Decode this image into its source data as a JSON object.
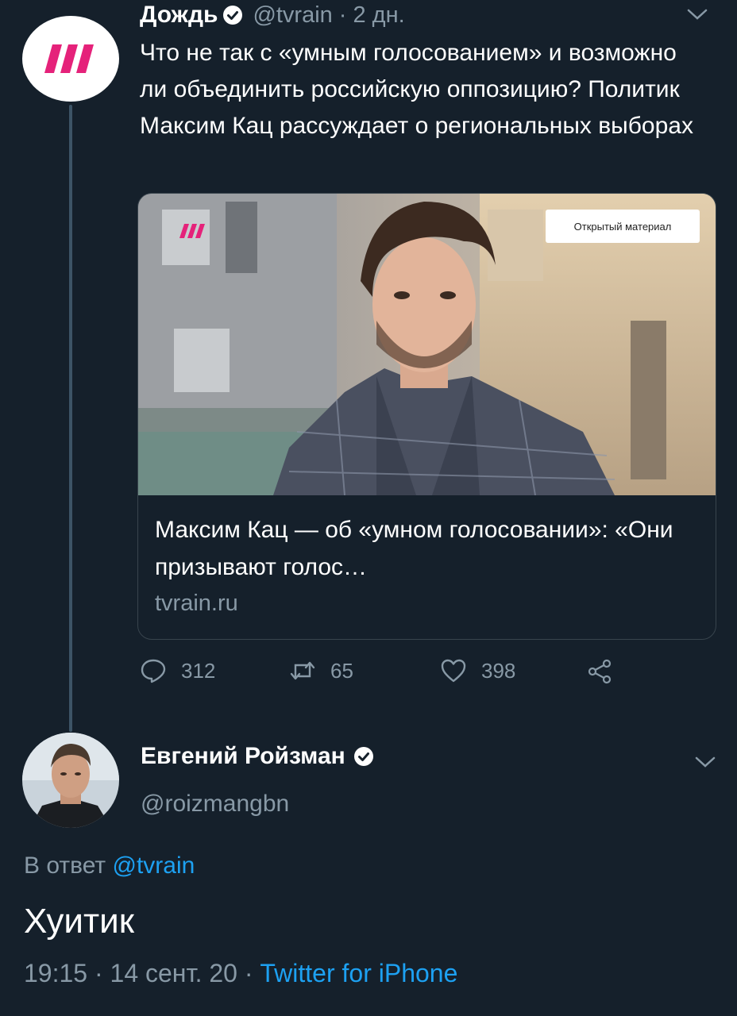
{
  "tweet1": {
    "name": "Дождь",
    "handle": "@tvrain",
    "separator": "·",
    "time": "2 дн.",
    "text": "Что не так с «умным голосованием» и возможно ли объединить российскую оппозицию? Политик Максим Кац рассуждает о региональных выборах",
    "card": {
      "badge": "Открытый материал",
      "title": "Максим Кац — об «умном голосовании»: «Они призывают голос…",
      "domain": "tvrain.ru"
    },
    "actions": {
      "replies": "312",
      "retweets": "65",
      "likes": "398"
    }
  },
  "tweet2": {
    "name": "Евгений Ройзман",
    "handle": "@roizmangbn",
    "replying_prefix": "В ответ",
    "replying_to": "@tvrain",
    "text": "Хуитик",
    "time": "19:15",
    "sep": "·",
    "date": "14 сент. 20",
    "sep2": "·",
    "source": "Twitter for iPhone"
  },
  "colors": {
    "background": "#15202b",
    "secondary_text": "#8899a6",
    "link": "#1da1f2",
    "brand_pink": "#e5227a",
    "border": "#38444d"
  }
}
